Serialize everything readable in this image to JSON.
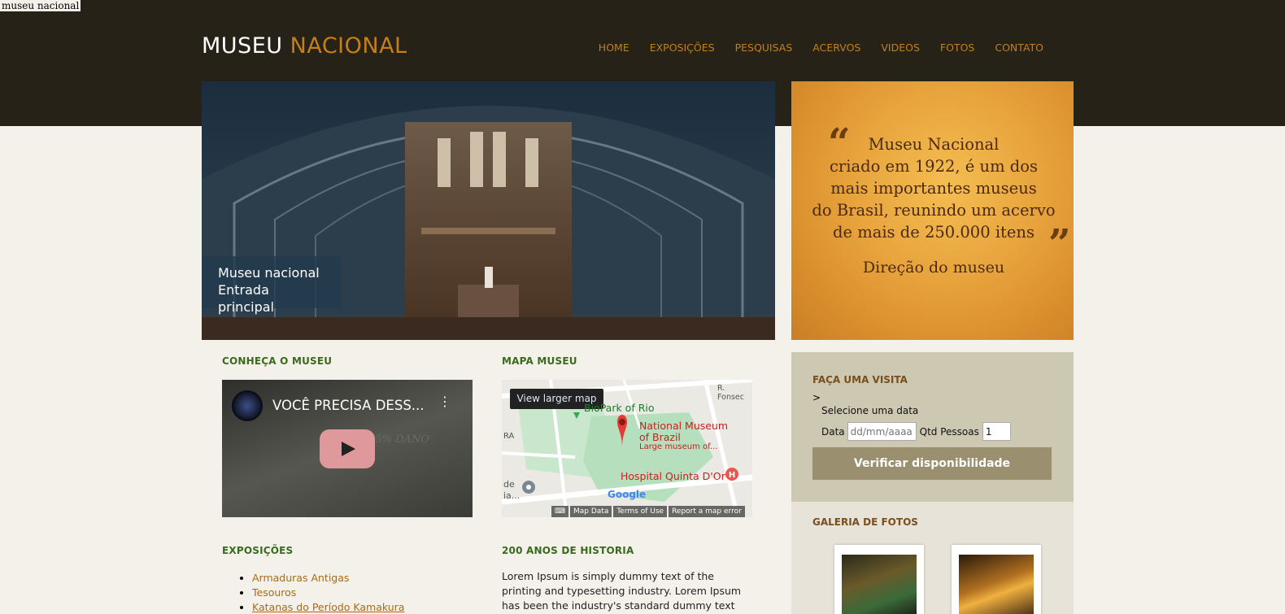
{
  "document_title": "museu nacional",
  "logo": {
    "word1": "MUSEU",
    "word2": "NACIONAL"
  },
  "nav": [
    "HOME",
    "EXPOSIÇÕES",
    "PESQUISAS",
    "ACERVOS",
    "VIDEOS",
    "FOTOS",
    "CONTATO"
  ],
  "hero": {
    "caption_line1": "Museu nacional",
    "caption_line2": "Entrada principal"
  },
  "quote": {
    "open_mark": "“",
    "close_mark": "”",
    "lines": [
      "Museu Nacional",
      "criado em 1922, é um dos",
      "mais importantes museus",
      "do Brasil, reunindo um acervo",
      "de mais de 250.000 itens"
    ],
    "author": "Direção do museu"
  },
  "sections": {
    "conheca": "CONHEÇA O MUSEU",
    "mapa": "MAPA MUSEU",
    "exposicoes": "EXPOSIÇÕES",
    "historia": "200 ANOS DE HISTORIA"
  },
  "video": {
    "title": "VOCÊ PRECISA DESS...",
    "overlay_text": "75% DANO"
  },
  "map": {
    "larger_link": "View larger map",
    "place_name_line1": "National Museum",
    "place_name_line2": "of Brazil",
    "place_desc": "Large museum of...",
    "biopark": "BioPark of Rio",
    "hospital": "Hospital Quinta D'Or",
    "street": "R. Fonsec",
    "left_text1": "RA",
    "left_text2": "de",
    "left_text3": "ia...",
    "google": "Google",
    "footer": [
      "Map Data",
      "Terms of Use",
      "Report a map error"
    ]
  },
  "visit": {
    "title": "FAÇA UMA VISITA",
    "gt": ">",
    "select_label": "Selecione uma data",
    "date_label": "Data",
    "date_placeholder": "dd/mm/aaaa",
    "qty_label": "Qtd Pessoas",
    "qty_value": "1",
    "button": "Verificar disponibilidade"
  },
  "gallery": {
    "title": "GALERIA DE FOTOS"
  },
  "exhibitions": [
    "Armaduras Antigas",
    "Tesouros",
    "Katanas do Período Kamakura"
  ],
  "history_text": "Lorem Ipsum is simply dummy text of the printing and typesetting industry. Lorem Ipsum has been the industry's standard dummy text ever since the",
  "colors": {
    "header_bg": "#262217",
    "accent": "#c47f1a",
    "section_green": "#3a6a1e",
    "page_bg": "#f3f1ea"
  }
}
